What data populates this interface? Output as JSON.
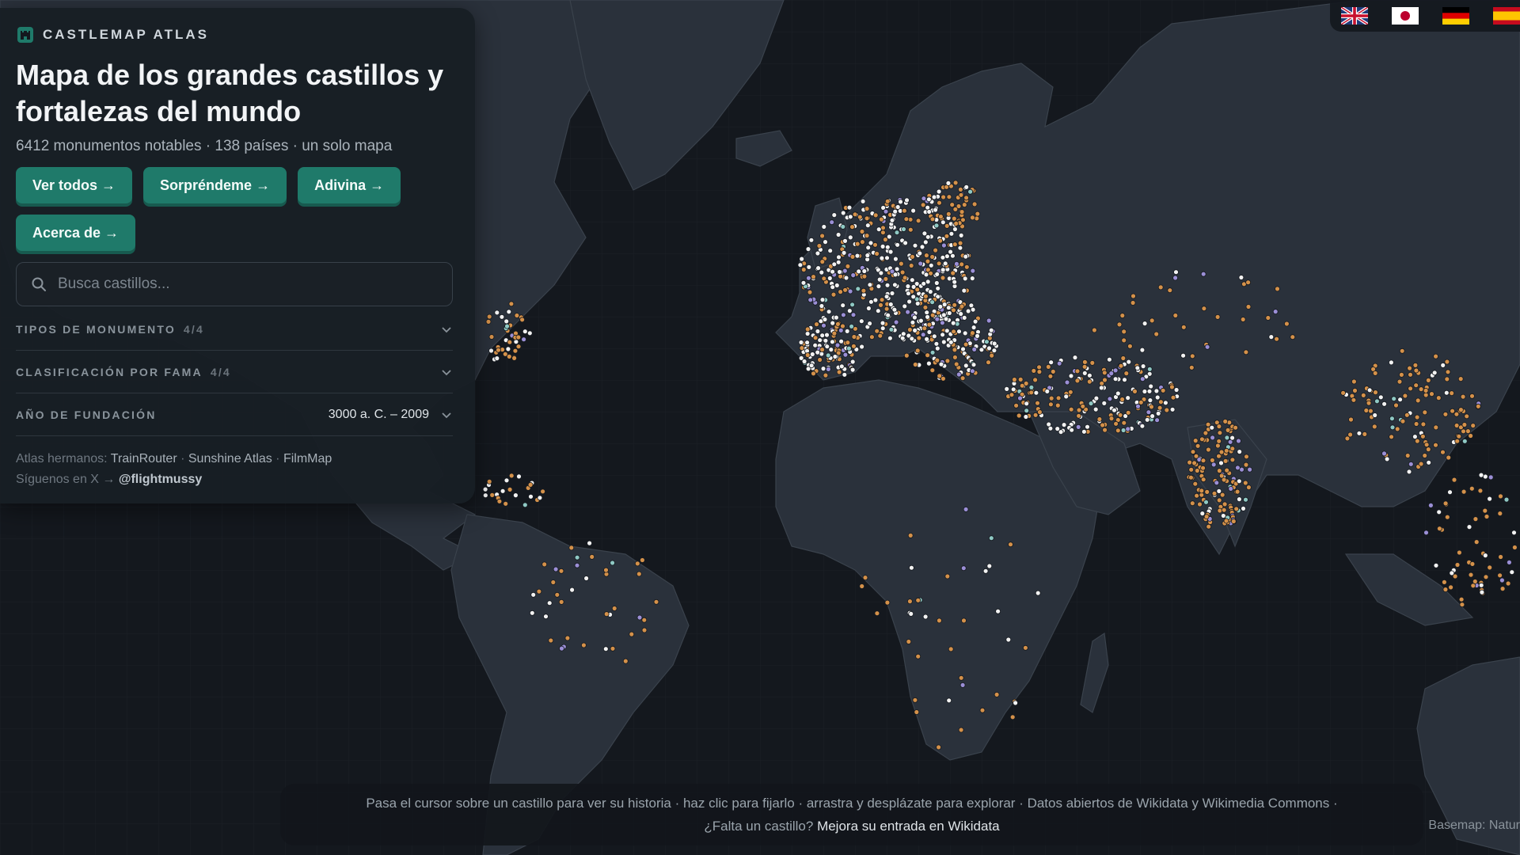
{
  "app": {
    "brand": "CASTLEMAP ATLAS",
    "title_line1": "Mapa de los grandes castillos y",
    "title_line2": "fortalezas del mundo",
    "subtitle": "6412 monumentos notables · 138 países · un solo mapa"
  },
  "buttons": {
    "ver_todos": "Ver todos →",
    "sorprendeme": "Sorpréndeme →",
    "adivina": "Adivina →",
    "acerca": "Acerca de →"
  },
  "search": {
    "placeholder": "Busca castillos..."
  },
  "filters": [
    {
      "label": "TIPOS DE MONUMENTO",
      "count": "4/4",
      "value": ""
    },
    {
      "label": "CLASIFICACIÓN POR FAMA",
      "count": "4/4",
      "value": ""
    },
    {
      "label": "AÑO DE FUNDACIÓN",
      "count": "",
      "value": "3000 a. C. – 2009"
    }
  ],
  "sister_atlases": {
    "prefix": "Atlas hermanos:",
    "links": [
      "TrainRouter",
      "Sunshine Atlas",
      "FilmMap"
    ],
    "follow_prefix": "Síguenos en X →",
    "handle": "@flightmussy"
  },
  "languages": [
    "en-gb-flag-icon",
    "jp-flag-icon",
    "de-flag-icon",
    "es-flag-icon"
  ],
  "bottom_bar": {
    "line1": "Pasa el cursor sobre un castillo para ver su historia · haz clic para fijarlo · arrastra y desplázate para explorar  ·  Datos abiertos de Wikidata y Wikimedia Commons ·",
    "line2_prefix": "¿Falta un castillo?",
    "line2_link": "Mejora su entrada en Wikidata"
  },
  "attribution": "Basemap: Natur",
  "colors": {
    "accent": "#1f7a6a",
    "marker_orange": "#d4914a",
    "marker_white": "#f2f2f2",
    "marker_purple": "#9b8fd6",
    "marker_teal": "#8fc9c4",
    "land": "#2a313b",
    "ocean": "#14181e"
  }
}
